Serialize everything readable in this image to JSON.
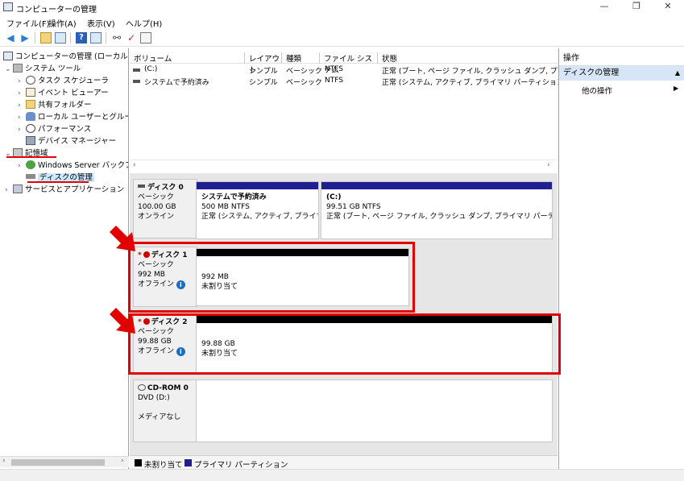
{
  "window": {
    "title": "コンピューターの管理",
    "minimize": "—",
    "maximize": "❐",
    "close": "✕"
  },
  "menu": [
    "ファイル(F)",
    "操作(A)",
    "表示(V)",
    "ヘルプ(H)"
  ],
  "tree": {
    "root": "コンピューターの管理 (ローカル)",
    "system_tools": "システム ツール",
    "task_scheduler": "タスク スケジューラ",
    "event_viewer": "イベント ビューアー",
    "shared_folders": "共有フォルダー",
    "local_users": "ローカル ユーザーとグループ",
    "performance": "パフォーマンス",
    "device_manager": "デバイス マネージャー",
    "storage": "記憶域",
    "windows_server_backup": "Windows Server バックア",
    "disk_management": "ディスクの管理",
    "services_apps": "サービスとアプリケーション"
  },
  "volume_list": {
    "columns": [
      "ボリューム",
      "レイアウト",
      "種類",
      "ファイル システム",
      "状態"
    ],
    "rows": [
      {
        "volume": "(C:)",
        "layout": "シンプル",
        "type": "ベーシック",
        "fs": "NTFS",
        "status": "正常 (ブート, ページ ファイル, クラッシュ ダンプ, プライマリ"
      },
      {
        "volume": "システムで予約済み",
        "layout": "シンプル",
        "type": "ベーシック",
        "fs": "NTFS",
        "status": "正常 (システム, アクティブ, プライマリ パーティション)"
      }
    ]
  },
  "disks": {
    "disk0": {
      "name": "ディスク 0",
      "type": "ベーシック",
      "size": "100.00 GB",
      "state": "オンライン",
      "p1": {
        "name": "システムで予約済み",
        "size": "500 MB NTFS",
        "status": "正常 (システム, アクティブ, プライマリ パ"
      },
      "p2": {
        "name": "(C:)",
        "size": "99.51 GB NTFS",
        "status": "正常 (ブート, ページ ファイル, クラッシュ ダンプ, プライマリ パーティション)"
      }
    },
    "disk1": {
      "marker": "*",
      "name": "ディスク 1",
      "type": "ベーシック",
      "size": "992 MB",
      "state": "オフライン",
      "part_size": "992 MB",
      "part_status": "未割り当て"
    },
    "disk2": {
      "marker": "*",
      "name": "ディスク 2",
      "type": "ベーシック",
      "size": "99.88 GB",
      "state": "オフライン",
      "part_size": "99.88 GB",
      "part_status": "未割り当て"
    },
    "cdrom": {
      "name": "CD-ROM 0",
      "drive": "DVD (D:)",
      "media": "メディアなし"
    }
  },
  "legend": {
    "unallocated": "未割り当て",
    "primary": "プライマリ パーティション"
  },
  "actions": {
    "header": "操作",
    "section": "ディスクの管理",
    "other": "他の操作"
  },
  "colors": {
    "highlight_red": "#e00000",
    "primary_partition": "#1f1f8f",
    "unallocated": "#000000",
    "action_section": "#d6e6f6",
    "info_icon": "#1a6ec2"
  },
  "icons": [
    "back-icon",
    "forward-icon",
    "up-icon",
    "show-hide-tree-icon",
    "help-icon",
    "properties-icon",
    "connect-icon",
    "check-icon",
    "list-icon"
  ]
}
